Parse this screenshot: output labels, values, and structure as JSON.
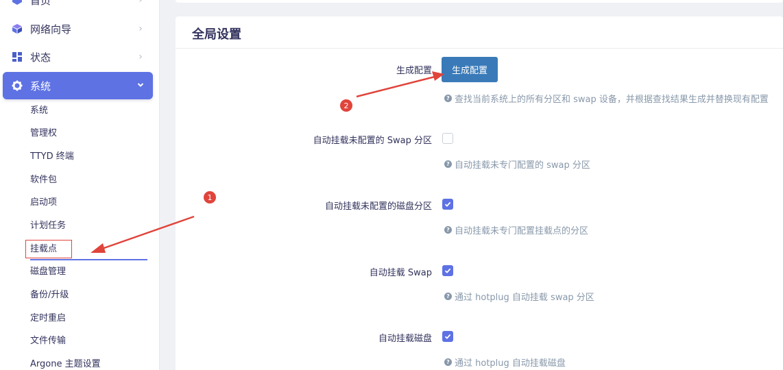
{
  "sidebar": {
    "menu": [
      {
        "label": "首页",
        "icon": "home-icon"
      },
      {
        "label": "网络向导",
        "icon": "cube-icon"
      },
      {
        "label": "状态",
        "icon": "grid-icon"
      },
      {
        "label": "系统",
        "icon": "gear-icon"
      }
    ],
    "submenu": [
      "系统",
      "管理权",
      "TTYD 终端",
      "软件包",
      "启动项",
      "计划任务",
      "挂载点",
      "磁盘管理",
      "备份/升级",
      "定时重启",
      "文件传输",
      "Argone 主题设置"
    ]
  },
  "main": {
    "title": "全局设置",
    "generate": {
      "label": "生成配置",
      "button": "生成配置",
      "help": "查找当前系统上的所有分区和 swap 设备，并根据查找结果生成并替换现有配置"
    },
    "options": [
      {
        "label": "自动挂载未配置的 Swap 分区",
        "checked": false,
        "help": "自动挂载未专门配置的 swap 分区"
      },
      {
        "label": "自动挂载未配置的磁盘分区",
        "checked": true,
        "help": "自动挂载未专门配置挂载点的分区"
      },
      {
        "label": "自动挂载 Swap",
        "checked": true,
        "help": "通过 hotplug 自动挂载 swap 分区"
      },
      {
        "label": "自动挂载磁盘",
        "checked": true,
        "help": "通过 hotplug 自动挂载磁盘"
      }
    ]
  },
  "annotations": {
    "badge1": "1",
    "badge2": "2"
  },
  "colors": {
    "accent": "#5e72e4",
    "button": "#3a7ab8",
    "annotation": "#e0443b"
  }
}
